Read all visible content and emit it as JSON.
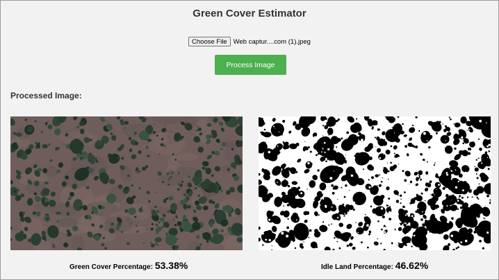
{
  "header": {
    "title": "Green Cover Estimator"
  },
  "upload": {
    "choose_file_label": "Choose File",
    "file_name": "Web captur....com (1).jpeg"
  },
  "actions": {
    "process_label": "Process Image",
    "process_color": "#4caf50"
  },
  "result": {
    "heading": "Processed Image:",
    "original_image": "satellite-vegetation-image",
    "mask_image": "binary-vegetation-mask",
    "green_cover_label": "Green Cover Percentage:",
    "green_cover_value": "53.38%",
    "idle_land_label": "Idle Land Percentage:",
    "idle_land_value": "46.62%"
  }
}
